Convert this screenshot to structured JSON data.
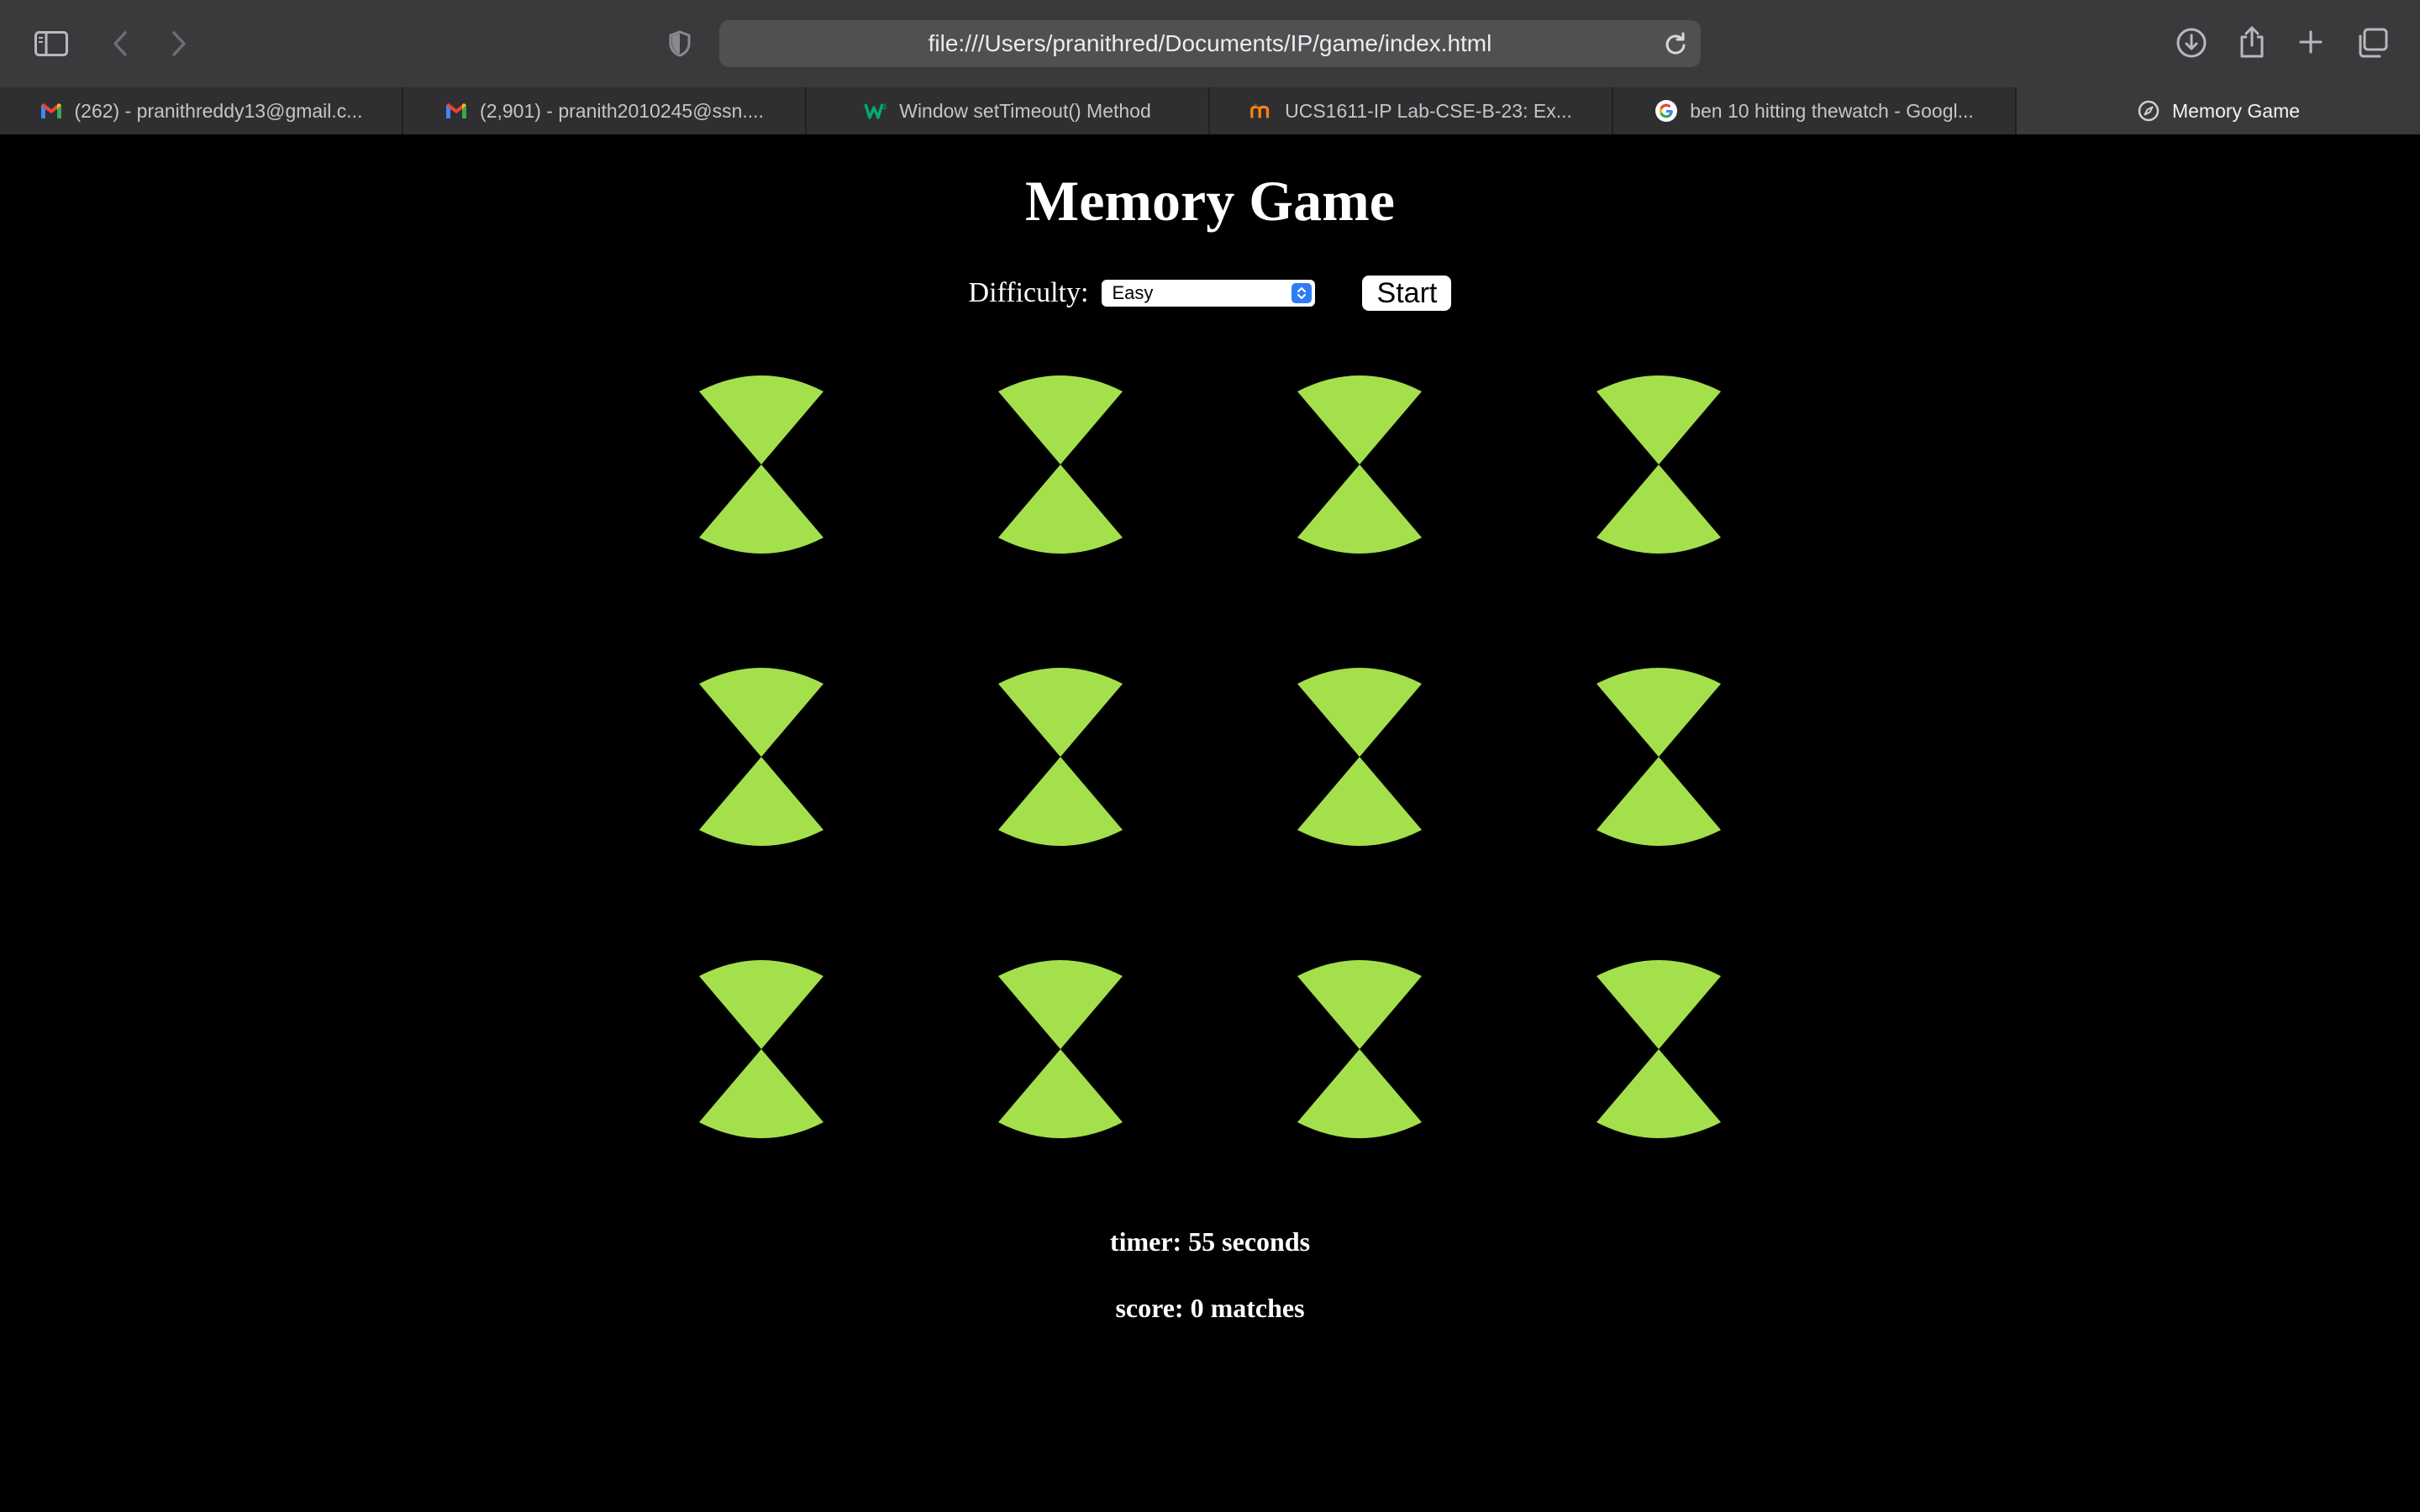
{
  "browser": {
    "url": "file:///Users/pranithred/Documents/IP/game/index.html",
    "tabs": [
      {
        "label": "(262) - pranithreddy13@gmail.c...",
        "icon": "gmail-icon",
        "active": false
      },
      {
        "label": "(2,901) - pranith2010245@ssn....",
        "icon": "gmail-icon",
        "active": false
      },
      {
        "label": "Window setTimeout() Method",
        "icon": "w3schools-icon",
        "active": false
      },
      {
        "label": "UCS1611-IP Lab-CSE-B-23: Ex...",
        "icon": "moodle-icon",
        "active": false
      },
      {
        "label": "ben 10 hitting thewatch - Googl...",
        "icon": "google-icon",
        "active": false
      },
      {
        "label": "Memory Game",
        "icon": "compass-icon",
        "active": true
      }
    ]
  },
  "page": {
    "title": "Memory Game",
    "difficulty_label": "Difficulty:",
    "difficulty_value": "Easy",
    "start_label": "Start",
    "timer": "timer: 55 seconds",
    "score": "score: 0 matches"
  },
  "cards": {
    "count": 12,
    "columns": 4,
    "back_color": "#a4e04c",
    "back_icon": "omnitrix-icon"
  }
}
